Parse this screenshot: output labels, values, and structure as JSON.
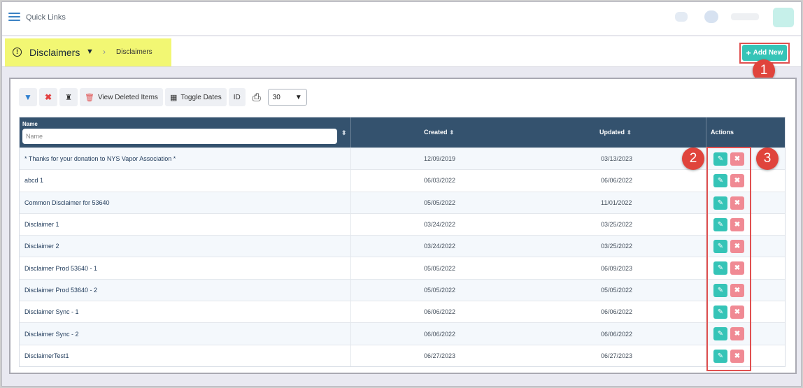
{
  "topbar": {
    "quick_links": "Quick Links"
  },
  "header": {
    "title": "Disclaimers",
    "breadcrumb_leaf": "Disclaimers",
    "add_new_label": "Add New"
  },
  "callouts": [
    "1",
    "2",
    "3"
  ],
  "toolbar": {
    "view_deleted": "View Deleted Items",
    "toggle_dates": "Toggle Dates",
    "id_label": "ID",
    "page_size": "30"
  },
  "table": {
    "col_name": "Name",
    "name_filter_placeholder": "Name",
    "col_created": "Created",
    "col_updated": "Updated",
    "col_actions": "Actions",
    "rows": [
      {
        "name": "* Thanks for your donation to NYS Vapor Association *",
        "created": "12/09/2019",
        "updated": "03/13/2023"
      },
      {
        "name": "abcd 1",
        "created": "06/03/2022",
        "updated": "06/06/2022"
      },
      {
        "name": "Common Disclaimer for 53640",
        "created": "05/05/2022",
        "updated": "11/01/2022"
      },
      {
        "name": "Disclaimer 1",
        "created": "03/24/2022",
        "updated": "03/25/2022"
      },
      {
        "name": "Disclaimer 2",
        "created": "03/24/2022",
        "updated": "03/25/2022"
      },
      {
        "name": "Disclaimer Prod 53640 - 1",
        "created": "05/05/2022",
        "updated": "06/09/2023"
      },
      {
        "name": "Disclaimer Prod 53640 - 2",
        "created": "05/05/2022",
        "updated": "05/05/2022"
      },
      {
        "name": "Disclaimer Sync - 1",
        "created": "06/06/2022",
        "updated": "06/06/2022"
      },
      {
        "name": "Disclaimer Sync - 2",
        "created": "06/06/2022",
        "updated": "06/06/2022"
      },
      {
        "name": "DisclaimerTest1",
        "created": "06/27/2023",
        "updated": "06/27/2023"
      }
    ]
  },
  "colors": {
    "accent_teal": "#35c4b7",
    "delete_pink": "#f08a94",
    "header_navy": "#34526e",
    "highlight_yellow": "#f2f773",
    "callout_red": "#e0443c"
  }
}
